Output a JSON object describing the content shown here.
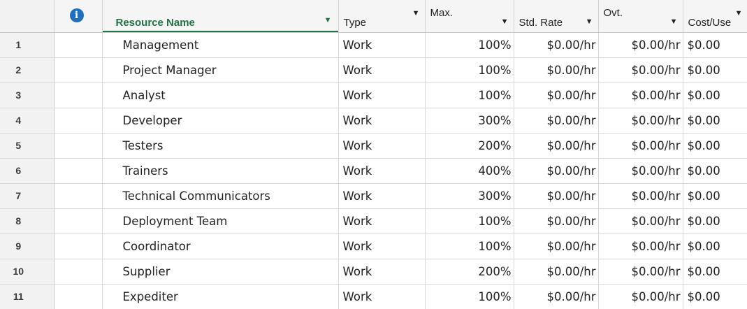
{
  "columns": {
    "info_icon": "info-icon",
    "resource_name": "Resource Name",
    "type": "Type",
    "max": "Max.",
    "std_rate": "Std. Rate",
    "ovt": "Ovt.",
    "cost_use": "Cost/Use"
  },
  "accent_color": "#217346",
  "rows": [
    {
      "id": "1",
      "name": "Management",
      "type": "Work",
      "max": "100%",
      "std_rate": "$0.00/hr",
      "ovt": "$0.00/hr",
      "cost_use": "$0.00"
    },
    {
      "id": "2",
      "name": "Project Manager",
      "type": "Work",
      "max": "100%",
      "std_rate": "$0.00/hr",
      "ovt": "$0.00/hr",
      "cost_use": "$0.00"
    },
    {
      "id": "3",
      "name": "Analyst",
      "type": "Work",
      "max": "100%",
      "std_rate": "$0.00/hr",
      "ovt": "$0.00/hr",
      "cost_use": "$0.00"
    },
    {
      "id": "4",
      "name": "Developer",
      "type": "Work",
      "max": "300%",
      "std_rate": "$0.00/hr",
      "ovt": "$0.00/hr",
      "cost_use": "$0.00"
    },
    {
      "id": "5",
      "name": "Testers",
      "type": "Work",
      "max": "200%",
      "std_rate": "$0.00/hr",
      "ovt": "$0.00/hr",
      "cost_use": "$0.00"
    },
    {
      "id": "6",
      "name": "Trainers",
      "type": "Work",
      "max": "400%",
      "std_rate": "$0.00/hr",
      "ovt": "$0.00/hr",
      "cost_use": "$0.00"
    },
    {
      "id": "7",
      "name": "Technical Communicators",
      "type": "Work",
      "max": "300%",
      "std_rate": "$0.00/hr",
      "ovt": "$0.00/hr",
      "cost_use": "$0.00"
    },
    {
      "id": "8",
      "name": "Deployment Team",
      "type": "Work",
      "max": "100%",
      "std_rate": "$0.00/hr",
      "ovt": "$0.00/hr",
      "cost_use": "$0.00"
    },
    {
      "id": "9",
      "name": "Coordinator",
      "type": "Work",
      "max": "100%",
      "std_rate": "$0.00/hr",
      "ovt": "$0.00/hr",
      "cost_use": "$0.00"
    },
    {
      "id": "10",
      "name": "Supplier",
      "type": "Work",
      "max": "200%",
      "std_rate": "$0.00/hr",
      "ovt": "$0.00/hr",
      "cost_use": "$0.00"
    },
    {
      "id": "11",
      "name": "Expediter",
      "type": "Work",
      "max": "100%",
      "std_rate": "$0.00/hr",
      "ovt": "$0.00/hr",
      "cost_use": "$0.00"
    }
  ]
}
